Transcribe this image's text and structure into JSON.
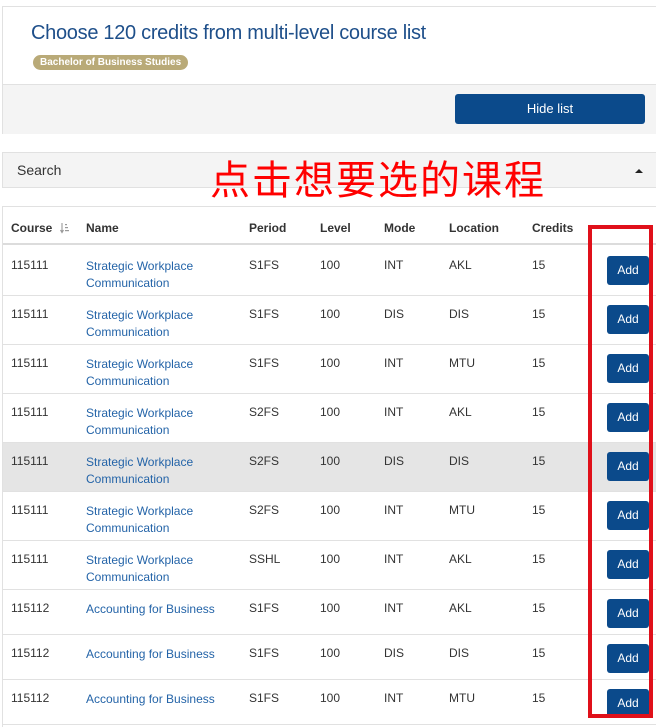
{
  "header": {
    "title": "Choose 120 credits from multi-level course list",
    "badge": "Bachelor of Business Studies",
    "hide_button": "Hide list"
  },
  "search": {
    "label": "Search"
  },
  "annotation": "点击想要选的课程",
  "table": {
    "columns": [
      "Course",
      "Name",
      "Period",
      "Level",
      "Mode",
      "Location",
      "Credits"
    ],
    "add_label": "Add",
    "rows": [
      {
        "course": "115111",
        "name": "Strategic Workplace Communication",
        "period": "S1FS",
        "level": "100",
        "mode": "INT",
        "location": "AKL",
        "credits": "15"
      },
      {
        "course": "115111",
        "name": "Strategic Workplace Communication",
        "period": "S1FS",
        "level": "100",
        "mode": "DIS",
        "location": "DIS",
        "credits": "15"
      },
      {
        "course": "115111",
        "name": "Strategic Workplace Communication",
        "period": "S1FS",
        "level": "100",
        "mode": "INT",
        "location": "MTU",
        "credits": "15"
      },
      {
        "course": "115111",
        "name": "Strategic Workplace Communication",
        "period": "S2FS",
        "level": "100",
        "mode": "INT",
        "location": "AKL",
        "credits": "15"
      },
      {
        "course": "115111",
        "name": "Strategic Workplace Communication",
        "period": "S2FS",
        "level": "100",
        "mode": "DIS",
        "location": "DIS",
        "credits": "15"
      },
      {
        "course": "115111",
        "name": "Strategic Workplace Communication",
        "period": "S2FS",
        "level": "100",
        "mode": "INT",
        "location": "MTU",
        "credits": "15"
      },
      {
        "course": "115111",
        "name": "Strategic Workplace Communication",
        "period": "SSHL",
        "level": "100",
        "mode": "INT",
        "location": "AKL",
        "credits": "15"
      },
      {
        "course": "115112",
        "name": "Accounting for Business",
        "period": "S1FS",
        "level": "100",
        "mode": "INT",
        "location": "AKL",
        "credits": "15"
      },
      {
        "course": "115112",
        "name": "Accounting for Business",
        "period": "S1FS",
        "level": "100",
        "mode": "DIS",
        "location": "DIS",
        "credits": "15"
      },
      {
        "course": "115112",
        "name": "Accounting for Business",
        "period": "S1FS",
        "level": "100",
        "mode": "INT",
        "location": "MTU",
        "credits": "15"
      }
    ]
  },
  "colors": {
    "primary": "#0b4a8b",
    "link": "#2464a8",
    "annotation": "#ff0000",
    "badge": "#b9aa78",
    "highlight_row": "#e5e5e5"
  }
}
